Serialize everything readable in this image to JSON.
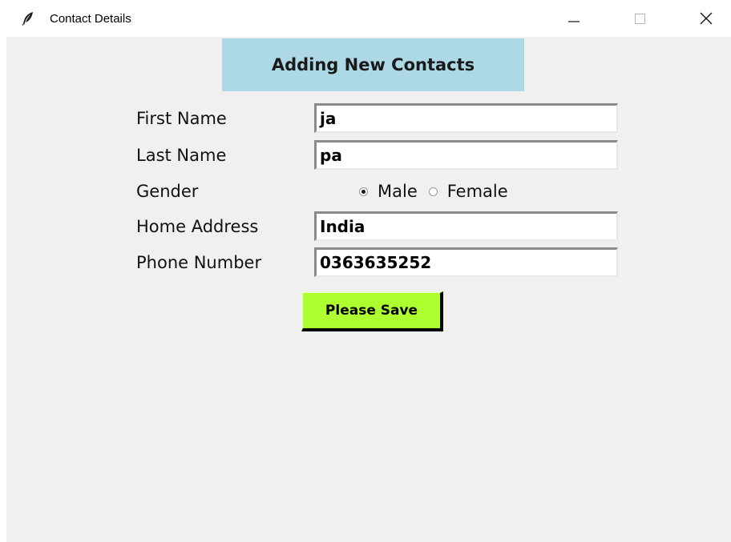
{
  "window": {
    "title": "Contact Details",
    "icon": "feather-icon",
    "controls": [
      "minimize-icon",
      "maximize-icon",
      "close-icon"
    ]
  },
  "form": {
    "heading": "Adding New Contacts",
    "heading_bg": "#add8e6",
    "first_name": {
      "label": "First Name",
      "value": "ja"
    },
    "last_name": {
      "label": "Last Name",
      "value": "pa"
    },
    "gender": {
      "label": "Gender",
      "options": [
        "Male",
        "Female"
      ],
      "selected": "Male"
    },
    "home_address": {
      "label": "Home Address",
      "value": "India"
    },
    "phone_number": {
      "label": "Phone Number",
      "value": "0363635252"
    },
    "save_button": {
      "label": "Please Save",
      "bg": "#adff2f"
    }
  }
}
